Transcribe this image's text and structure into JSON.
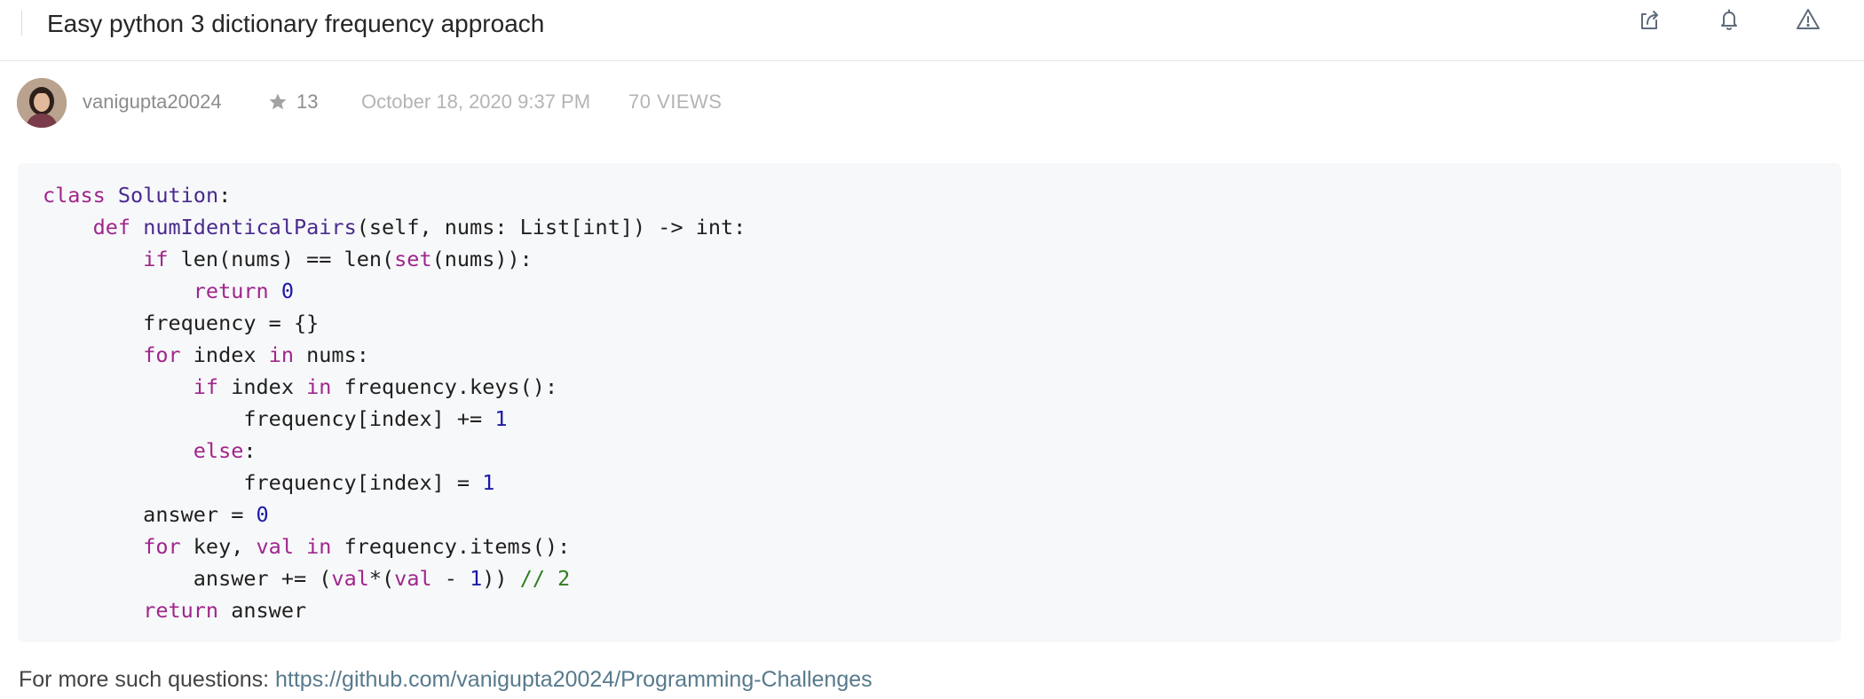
{
  "header": {
    "title": "Easy python 3 dictionary frequency approach",
    "actions": [
      {
        "name": "share-icon",
        "label": "share"
      },
      {
        "name": "bell-icon",
        "label": "notifications"
      },
      {
        "name": "warning-icon",
        "label": "report"
      }
    ]
  },
  "post_meta": {
    "username": "vanigupta20024",
    "reputation": "13",
    "date": "October 18, 2020 9:37 PM",
    "views": "70 VIEWS"
  },
  "code": {
    "language": "python",
    "lines": [
      [
        {
          "t": "kw",
          "v": "class"
        },
        {
          "t": "plain",
          "v": " "
        },
        {
          "t": "cls",
          "v": "Solution"
        },
        {
          "t": "plain",
          "v": ":"
        }
      ],
      [
        {
          "t": "plain",
          "v": "    "
        },
        {
          "t": "kw",
          "v": "def"
        },
        {
          "t": "plain",
          "v": " "
        },
        {
          "t": "fn",
          "v": "numIdenticalPairs"
        },
        {
          "t": "plain",
          "v": "(self, nums: List[int]) -> int:"
        }
      ],
      [
        {
          "t": "plain",
          "v": "        "
        },
        {
          "t": "kw",
          "v": "if"
        },
        {
          "t": "plain",
          "v": " len(nums) == len("
        },
        {
          "t": "builtin",
          "v": "set"
        },
        {
          "t": "plain",
          "v": "(nums)):"
        }
      ],
      [
        {
          "t": "plain",
          "v": "            "
        },
        {
          "t": "kw",
          "v": "return"
        },
        {
          "t": "plain",
          "v": " "
        },
        {
          "t": "num",
          "v": "0"
        }
      ],
      [
        {
          "t": "plain",
          "v": "        frequency = {}"
        }
      ],
      [
        {
          "t": "plain",
          "v": "        "
        },
        {
          "t": "kw",
          "v": "for"
        },
        {
          "t": "plain",
          "v": " index "
        },
        {
          "t": "kw",
          "v": "in"
        },
        {
          "t": "plain",
          "v": " nums:"
        }
      ],
      [
        {
          "t": "plain",
          "v": "            "
        },
        {
          "t": "kw",
          "v": "if"
        },
        {
          "t": "plain",
          "v": " index "
        },
        {
          "t": "kw",
          "v": "in"
        },
        {
          "t": "plain",
          "v": " frequency.keys():"
        }
      ],
      [
        {
          "t": "plain",
          "v": "                frequency[index] += "
        },
        {
          "t": "num",
          "v": "1"
        }
      ],
      [
        {
          "t": "plain",
          "v": "            "
        },
        {
          "t": "kw",
          "v": "else"
        },
        {
          "t": "plain",
          "v": ":"
        }
      ],
      [
        {
          "t": "plain",
          "v": "                frequency[index] = "
        },
        {
          "t": "num",
          "v": "1"
        }
      ],
      [
        {
          "t": "plain",
          "v": "        answer = "
        },
        {
          "t": "num",
          "v": "0"
        }
      ],
      [
        {
          "t": "plain",
          "v": "        "
        },
        {
          "t": "kw",
          "v": "for"
        },
        {
          "t": "plain",
          "v": " key, "
        },
        {
          "t": "builtin",
          "v": "val"
        },
        {
          "t": "plain",
          "v": " "
        },
        {
          "t": "kw",
          "v": "in"
        },
        {
          "t": "plain",
          "v": " frequency.items():"
        }
      ],
      [
        {
          "t": "plain",
          "v": "            answer += ("
        },
        {
          "t": "builtin",
          "v": "val"
        },
        {
          "t": "plain",
          "v": "*("
        },
        {
          "t": "builtin",
          "v": "val"
        },
        {
          "t": "plain",
          "v": " - "
        },
        {
          "t": "num",
          "v": "1"
        },
        {
          "t": "plain",
          "v": ")) "
        },
        {
          "t": "cm",
          "v": "// 2"
        }
      ],
      [
        {
          "t": "plain",
          "v": "        "
        },
        {
          "t": "kw",
          "v": "return"
        },
        {
          "t": "plain",
          "v": " answer"
        }
      ]
    ]
  },
  "footer": {
    "prefix": "For more such questions: ",
    "link_text": "https://github.com/vanigupta20024/Programming-Challenges"
  },
  "colors": {
    "keyword": "#a0268b",
    "class_name": "#4a2a8c",
    "number": "#1a1aa6",
    "comment": "#2f7d1f",
    "link": "#577a8c",
    "code_background": "#f7f8fa"
  }
}
